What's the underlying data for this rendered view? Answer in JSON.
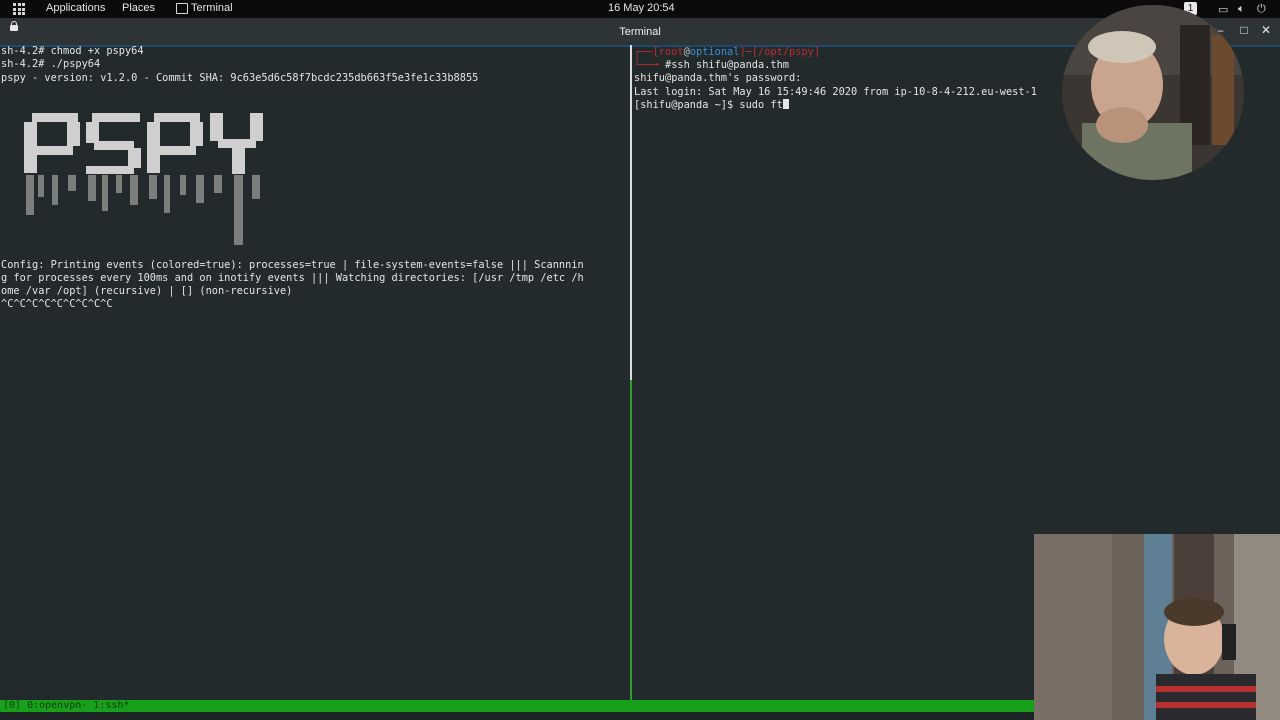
{
  "topbar": {
    "applications": "Applications",
    "places": "Places",
    "terminal": "Terminal",
    "clock": "16 May 20:54",
    "workspace_badge": "1"
  },
  "window": {
    "title": "Terminal"
  },
  "left_pane": {
    "lines": [
      "sh-4.2# chmod +x pspy64",
      "sh-4.2# ./pspy64",
      "pspy - version: v1.2.0 - Commit SHA: 9c63e5d6c58f7bcdc235db663f5e3fe1c33b8855"
    ],
    "banner_text": "PSPY",
    "config_lines": [
      "Config: Printing events (colored=true): processes=true | file-system-events=false ||| Scannnin",
      "g for processes every 100ms and on inotify events ||| Watching directories: [/usr /tmp /etc /h",
      "ome /var /opt] (recursive) | [] (non-recursive)",
      "^C^C^C^C^C^C^C^C^C"
    ]
  },
  "right_pane": {
    "prompt_user": "root",
    "prompt_host": "optional",
    "prompt_path": "/opt/pspy",
    "command": "#ssh shifu@panda.thm",
    "lines": [
      "shifu@panda.thm's password:",
      "Last login: Sat May 16 15:49:46 2020 from ip-10-8-4-212.eu-west-1"
    ],
    "current_prompt": "[shifu@panda ~]$ sudo ft"
  },
  "statusbar": {
    "text": "[0] 0:openvpn- 1:ssh*"
  },
  "colors": {
    "terminal_bg": "#232a2c",
    "tmux_status": "#17a01a",
    "prompt_red": "#c02a2a",
    "prompt_blue": "#3a8fd8"
  }
}
